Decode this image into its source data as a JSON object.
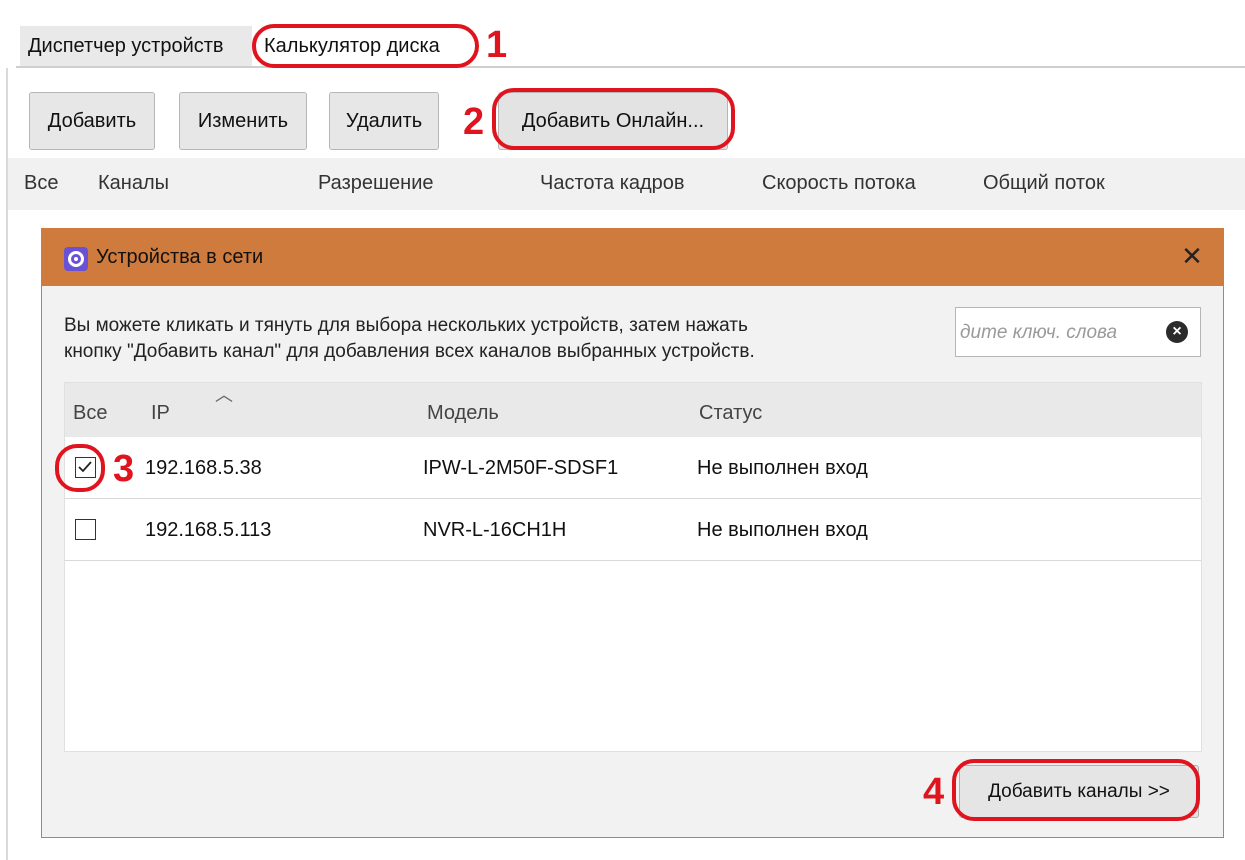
{
  "tabs": [
    {
      "label": "Диспетчер устройств"
    },
    {
      "label": "Калькулятор диска"
    }
  ],
  "toolbar": {
    "add": "Добавить",
    "edit": "Изменить",
    "delete": "Удалить",
    "add_online": "Добавить Онлайн..."
  },
  "main_table": {
    "headers": [
      "Все",
      "Каналы",
      "Разрешение",
      "Частота кадров",
      "Скорость потока",
      "Общий поток"
    ]
  },
  "dialog": {
    "icon": "gear-icon",
    "title": "Устройства в сети",
    "close": "✕",
    "hint_line1": "Вы можете кликать и тянуть для выбора нескольких устройств, затем нажать",
    "hint_line2": "кнопку \"Добавить канал\" для добавления всех каналов выбранных устройств.",
    "search_placeholder": "дите ключ. слова",
    "columns": {
      "all": "Все",
      "ip": "IP",
      "model": "Модель",
      "status": "Статус"
    },
    "rows": [
      {
        "ip": "192.168.5.38",
        "model": "IPW-L-2M50F-SDSF1",
        "status": "Не выполнен вход",
        "checked": true
      },
      {
        "ip": "192.168.5.113",
        "model": "NVR-L-16CH1H",
        "status": "Не выполнен вход",
        "checked": false
      }
    ],
    "add_channels": "Добавить каналы >>"
  },
  "annotations": {
    "n1": "1",
    "n2": "2",
    "n3": "3",
    "n4": "4",
    "color": "#e0141e"
  },
  "colors": {
    "dialog_title": "#cf7b3d",
    "icon": "#6a52d7"
  }
}
